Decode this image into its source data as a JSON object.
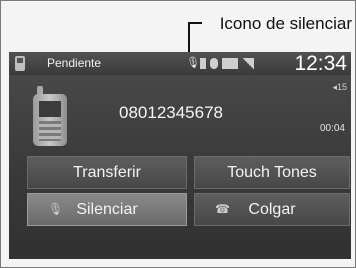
{
  "callout": {
    "label": "Icono de silenciar"
  },
  "status_bar": {
    "title": "Pendiente",
    "time": "12:34"
  },
  "call": {
    "number": "08012345678",
    "volume": "◂15",
    "duration": "00:04"
  },
  "buttons": {
    "transfer": "Transferir",
    "touch_tones": "Touch Tones",
    "mute": "Silenciar",
    "hang_up": "Colgar"
  }
}
